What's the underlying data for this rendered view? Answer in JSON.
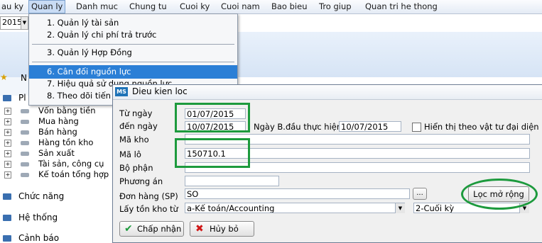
{
  "menubar": {
    "items": [
      "au ky",
      "Quan ly",
      "Danh muc",
      "Chung tu",
      "Cuoi ky",
      "Cuoi nam",
      "Bao bieu",
      "Tro giup",
      "Quan tri he thong"
    ]
  },
  "toolbar": {
    "year": "2015"
  },
  "quanly_menu": {
    "items": [
      "1. Quản lý tài sản",
      "2. Quản lý chi phí trả trước",
      "3. Quản lý Hợp Đồng",
      "6. Cân đối nguồn lực",
      "7. Hiệu quả sử dụng nguồn lực",
      "8. Theo dõi tiến đ"
    ]
  },
  "left_nav": {
    "top_label": "N",
    "top_item_label": "Pl",
    "tree": [
      "Vốn bằng tiền",
      "Mua hàng",
      "Bán hàng",
      "Hàng tồn kho",
      "Sản xuất",
      "Tài sản, công cụ",
      "Kế toán tổng hợp"
    ],
    "sections": [
      "Chức năng",
      "Hệ thống",
      "Cảnh báo"
    ]
  },
  "dialog": {
    "title": "Dieu kien loc",
    "logo": "MS",
    "tu_ngay_label": "Từ ngày",
    "tu_ngay_value": "01/07/2015",
    "den_ngay_label": "đến ngày",
    "den_ngay_value": "10/07/2015",
    "ngay_bd_label": "Ngày B.đầu thực hiện",
    "ngay_bd_value": "10/07/2015",
    "hien_thi_label": "Hiển thị theo vật tư đại diện",
    "ma_kho_label": "Mã kho",
    "ma_lo_label": "Mã lô",
    "ma_lo_value": "150710.1",
    "bo_phan_label": "Bộ phận",
    "phuong_an_label": "Phương án",
    "don_hang_label": "Đơn hàng (SP)",
    "don_hang_value": "SO",
    "ellipsis_label": "...",
    "loc_mo_rong_label": "Lọc mở rộng",
    "lay_ton_label": "Lấy tồn kho từ",
    "lay_ton_value": "a-Kế toán/Accounting",
    "cuoi_ky_value": "2-Cuối kỳ",
    "chap_nhan_label": "Chấp nhận",
    "huy_bo_label": "Hủy bỏ"
  },
  "colors": {
    "highlight": "#2b7fd6",
    "annotation_green": "#1d9a3d"
  }
}
